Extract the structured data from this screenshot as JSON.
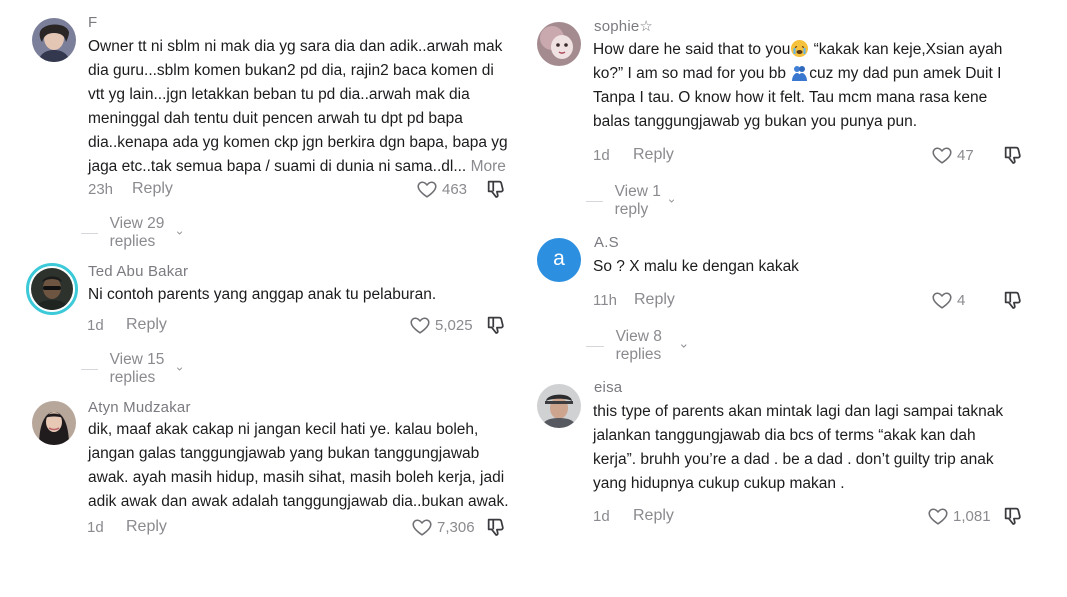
{
  "comments": [
    {
      "username": "F",
      "lines": [
        "Owner tt ni sblm ni mak dia yg sara dia dan adik..arwah mak",
        "dia guru...sblm komen bukan2 pd dia, rajin2 baca komen di",
        "vtt yg lain...jgn letakkan beban tu pd dia..arwah mak dia",
        "meninggal dah tentu duit pencen arwah tu dpt pd bapa",
        "dia..kenapa ada yg komen ckp jgn berkira dgn bapa, bapa yg",
        "jaga etc..tak semua bapa / suami di dunia ni sama..dl..."
      ],
      "more_label": "More",
      "time": "23h",
      "reply_label": "Reply",
      "likes": "463",
      "view_replies": "View 29 replies"
    },
    {
      "username": "Ted Abu Bakar",
      "lines": [
        "Ni contoh parents yang anggap anak tu pelaburan."
      ],
      "time": "1d",
      "reply_label": "Reply",
      "likes": "5,025",
      "view_replies": "View 15 replies"
    },
    {
      "username": "Atyn Mudzakar",
      "lines": [
        "dik, maaf akak cakap ni jangan kecil hati ye. kalau boleh,",
        "jangan galas tanggungjawab yang bukan tanggungjawab",
        "awak. ayah masih hidup, masih sihat, masih boleh kerja, jadi",
        "adik awak dan awak adalah tanggungjawab dia..bukan awak."
      ],
      "time": "1d",
      "reply_label": "Reply",
      "likes": "7,306"
    },
    {
      "username": "sophie☆",
      "line1_a": "How dare he said that to you",
      "line1_b": " “kakak kan keje,Xsian ayah",
      "line2_a": "ko?” I am so mad for you bb ",
      "line2_b": "cuz my dad pun amek Duit I",
      "line3": "Tanpa I tau. O know how it felt. Tau mcm mana rasa kene",
      "line4": "balas tanggungjawab yg bukan you punya pun.",
      "emoji1": "crying-face-emoji",
      "emoji2": "people-hugging-emoji",
      "time": "1d",
      "reply_label": "Reply",
      "likes": "47",
      "view_replies": "View 1 reply"
    },
    {
      "username": "A.S",
      "avatar_letter": "a",
      "avatar_color": "#2c8fe0",
      "lines": [
        "So ? X malu ke dengan kakak"
      ],
      "time": "11h",
      "reply_label": "Reply",
      "likes": "4",
      "view_replies": "View 8 replies"
    },
    {
      "username": "eisa",
      "lines": [
        "this type of parents akan mintak lagi dan lagi sampai taknak",
        "jalankan tanggungjawab dia bcs of terms “akak kan dah",
        "kerja”. bruhh you’re a dad . be a dad . don’t guilty trip anak",
        "yang hidupnya cukup cukup makan ."
      ],
      "time": "1d",
      "reply_label": "Reply",
      "likes": "1,081"
    }
  ]
}
